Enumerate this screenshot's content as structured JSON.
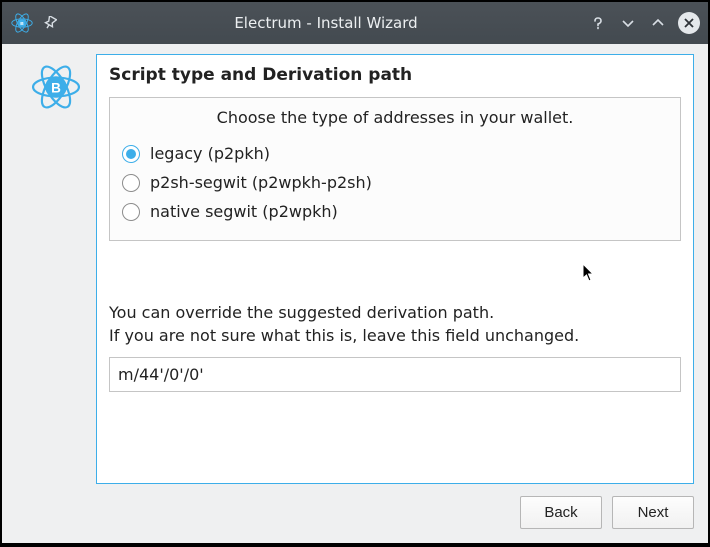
{
  "window": {
    "title": "Electrum  -  Install Wizard"
  },
  "colors": {
    "accent": "#3daee9"
  },
  "panel": {
    "heading": "Script type and Derivation path",
    "prompt": "Choose the type of addresses in your wallet.",
    "options": [
      {
        "label": "legacy (p2pkh)",
        "selected": true
      },
      {
        "label": "p2sh-segwit (p2wpkh-p2sh)",
        "selected": false
      },
      {
        "label": "native segwit (p2wpkh)",
        "selected": false
      }
    ],
    "hint_line1": "You can override the suggested derivation path.",
    "hint_line2": "If you are not sure what this is, leave this field unchanged.",
    "derivation_path": "m/44'/0'/0'"
  },
  "buttons": {
    "back": "Back",
    "next": "Next"
  }
}
